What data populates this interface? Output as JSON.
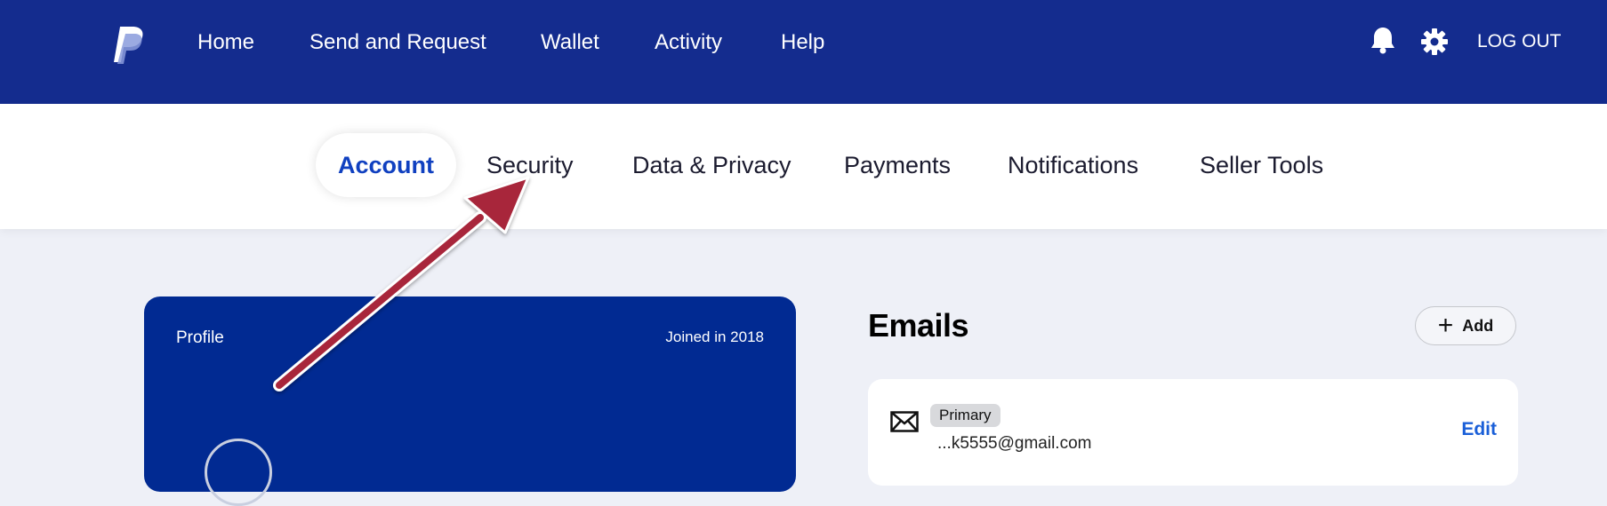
{
  "header": {
    "logo_icon": "paypal-logo",
    "nav": [
      "Home",
      "Send and Request",
      "Wallet",
      "Activity",
      "Help"
    ],
    "notification_icon": "bell-icon",
    "settings_icon": "gear-icon",
    "logout_label": "LOG OUT",
    "background_color": "#142c8e"
  },
  "subnav": {
    "tabs": [
      "Account",
      "Security",
      "Data & Privacy",
      "Payments",
      "Notifications",
      "Seller Tools"
    ],
    "active_tab": "Account",
    "active_color": "#1040c0"
  },
  "profile": {
    "label": "Profile",
    "joined": "Joined in 2018",
    "card_color": "#012a92"
  },
  "emails": {
    "title": "Emails",
    "add_label": "Add",
    "items": [
      {
        "badge": "Primary",
        "address": "...k5555@gmail.com",
        "edit_label": "Edit"
      }
    ]
  },
  "annotation": {
    "arrow_color": "#a8283a",
    "points_to": "Security"
  }
}
